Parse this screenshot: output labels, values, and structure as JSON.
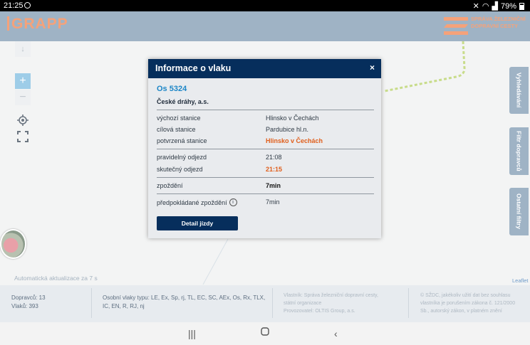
{
  "status_bar": {
    "time": "21:25",
    "battery": "79%"
  },
  "header": {
    "logo": "GRAPP",
    "partner_line1": "SPRÁVA ŽELEZNIČNÍ",
    "partner_line2": "DOPRAVNÍ CESTY"
  },
  "side_tabs": [
    {
      "label": "Vyhledávání"
    },
    {
      "label": "Filtr dopravců"
    },
    {
      "label": "Ostatní filtry"
    }
  ],
  "map": {
    "auto_update": "Automatická aktualizace za 7 s",
    "attribution": "Leaflet",
    "zoom_in": "+",
    "zoom_out": "−",
    "route_color": "#c8dc8a"
  },
  "dialog": {
    "title": "Informace o vlaku",
    "close": "×",
    "train": "Os 5324",
    "operator": "České dráhy, a.s.",
    "rows": [
      {
        "label": "výchozí stanice",
        "value": "Hlinsko v Čechách"
      },
      {
        "label": "cílová stanice",
        "value": "Pardubice hl.n."
      },
      {
        "label": "potvrzená stanice",
        "value": "Hlinsko v Čechách"
      },
      {
        "label": "pravidelný odjezd",
        "value": "21:08"
      },
      {
        "label": "skutečný odjezd",
        "value": "21:15"
      },
      {
        "label": "zpoždění",
        "value": "7min"
      },
      {
        "label": "předpokládané zpoždění",
        "value": "7min"
      }
    ],
    "detail_button": "Detail jízdy"
  },
  "footer": {
    "carriers": "Dopravců: 13",
    "trains": "Vlaků: 393",
    "types_line1": "Osobní vlaky typu: LE, Ex, Sp, rj, TL, EC, SC, AEx, Os, Rx, TLX,",
    "types_line2": "IC, EN, R, RJ, nj",
    "owner_line1": "Vlastník: Správa železniční dopravní cesty,",
    "owner_line2": "státní organizace",
    "owner_line3": "Provozovatel: OLTIS Group, a.s.",
    "legal_line1": "© SŽDC, jakékoliv užití dat bez souhlasu",
    "legal_line2": "vlastníka je porušením zákona č. 121/2000",
    "legal_line3": "Sb., autorský zákon, v platném znění"
  },
  "colors": {
    "header_bg": "#9fb3c5",
    "accent_orange": "#f5a27a",
    "dialog_head": "#062e5c",
    "highlight": "#e05e1b",
    "train_id": "#1c86c7"
  }
}
